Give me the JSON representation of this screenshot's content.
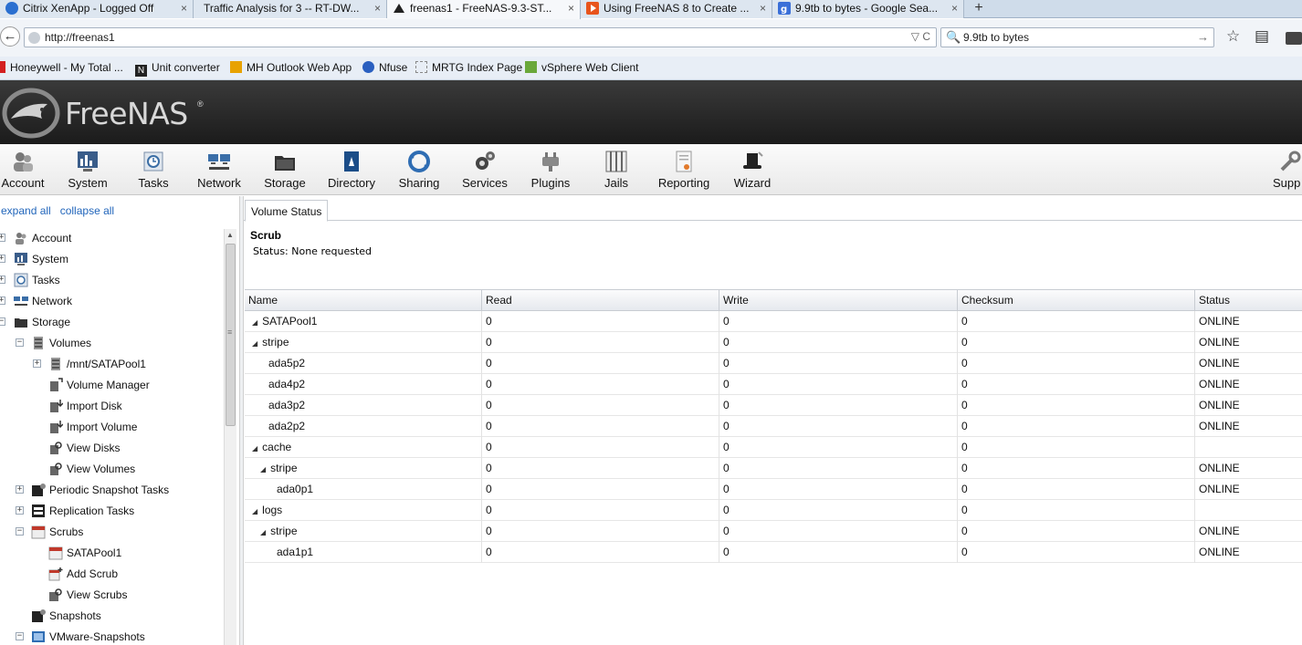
{
  "browser": {
    "tabs": [
      {
        "title": "Citrix XenApp - Logged Off",
        "icon": "citrix-icon",
        "color": "#2a6fd0"
      },
      {
        "title": "Traffic Analysis for 3 -- RT-DW...",
        "icon": "blank-page-icon",
        "color": "#e6e6e6"
      },
      {
        "title": "freenas1 - FreeNAS-9.3-ST...",
        "icon": "freenas-shark-icon",
        "color": "#222222"
      },
      {
        "title": "Using FreeNAS 8 to Create ...",
        "icon": "youtube-play-icon",
        "color": "#e8541c"
      },
      {
        "title": "9.9tb to bytes - Google Sea...",
        "icon": "google-icon",
        "color": "#3a6fd8"
      }
    ],
    "close_glyph": "×",
    "new_tab_glyph": "+",
    "back_glyph": "←",
    "url": "http://freenas1",
    "url_controls": "▽ C",
    "search_value": "9.9tb to bytes",
    "search_glyph": "🔍",
    "search_go": "→",
    "bookmark_star": "☆",
    "reading_list": "▤",
    "bookmarks": [
      {
        "label": "Honeywell - My Total ...",
        "color": "#d32020"
      },
      {
        "label": "Unit converter",
        "color": "#222222"
      },
      {
        "label": "MH Outlook Web App",
        "color": "#e8a200"
      },
      {
        "label": "Nfuse",
        "color": "#2a5fc0"
      },
      {
        "label": "MRTG Index Page",
        "color": "#bbbbbb"
      },
      {
        "label": "vSphere Web Client",
        "color": "#6aa83a"
      }
    ]
  },
  "header": {
    "logo_text": "FreeNAS",
    "logo_reg": "®"
  },
  "toolbar": {
    "items": [
      {
        "label": "Account"
      },
      {
        "label": "System"
      },
      {
        "label": "Tasks"
      },
      {
        "label": "Network"
      },
      {
        "label": "Storage"
      },
      {
        "label": "Directory"
      },
      {
        "label": "Sharing"
      },
      {
        "label": "Services"
      },
      {
        "label": "Plugins"
      },
      {
        "label": "Jails"
      },
      {
        "label": "Reporting"
      },
      {
        "label": "Wizard"
      },
      {
        "label": "Supp"
      }
    ]
  },
  "tree": {
    "expand_all": "expand all",
    "collapse_all": "collapse all",
    "nodes": [
      {
        "label": "Account",
        "exp": "+"
      },
      {
        "label": "System",
        "exp": "+"
      },
      {
        "label": "Tasks",
        "exp": "+"
      },
      {
        "label": "Network",
        "exp": "+"
      },
      {
        "label": "Storage",
        "exp": "−"
      },
      {
        "label": "Volumes",
        "exp": "−"
      },
      {
        "label": "/mnt/SATAPool1",
        "exp": "+"
      },
      {
        "label": "Volume Manager",
        "exp": ""
      },
      {
        "label": "Import Disk",
        "exp": ""
      },
      {
        "label": "Import Volume",
        "exp": ""
      },
      {
        "label": "View Disks",
        "exp": ""
      },
      {
        "label": "View Volumes",
        "exp": ""
      },
      {
        "label": "Periodic Snapshot Tasks",
        "exp": "+"
      },
      {
        "label": "Replication Tasks",
        "exp": "+"
      },
      {
        "label": "Scrubs",
        "exp": "−"
      },
      {
        "label": "SATAPool1",
        "exp": ""
      },
      {
        "label": "Add Scrub",
        "exp": ""
      },
      {
        "label": "View Scrubs",
        "exp": ""
      },
      {
        "label": "Snapshots",
        "exp": ""
      },
      {
        "label": "VMware-Snapshots",
        "exp": "−"
      }
    ],
    "scroll_up": "▲",
    "scroll_grip": "≡"
  },
  "content": {
    "tab_label": "Volume Status",
    "scrub_title": "Scrub",
    "scrub_status": "Status: None requested",
    "columns": [
      "Name",
      "Read",
      "Write",
      "Checksum",
      "Status"
    ],
    "tri_glyph": "◢",
    "rows": [
      {
        "name": "SATAPool1",
        "tri": true,
        "read": "0",
        "write": "0",
        "checksum": "0",
        "status": "ONLINE"
      },
      {
        "name": "stripe",
        "tri": true,
        "read": "0",
        "write": "0",
        "checksum": "0",
        "status": "ONLINE"
      },
      {
        "name": "ada5p2",
        "tri": false,
        "read": "0",
        "write": "0",
        "checksum": "0",
        "status": "ONLINE"
      },
      {
        "name": "ada4p2",
        "tri": false,
        "read": "0",
        "write": "0",
        "checksum": "0",
        "status": "ONLINE"
      },
      {
        "name": "ada3p2",
        "tri": false,
        "read": "0",
        "write": "0",
        "checksum": "0",
        "status": "ONLINE"
      },
      {
        "name": "ada2p2",
        "tri": false,
        "read": "0",
        "write": "0",
        "checksum": "0",
        "status": "ONLINE"
      },
      {
        "name": "cache",
        "tri": true,
        "read": "0",
        "write": "0",
        "checksum": "0",
        "status": ""
      },
      {
        "name": "stripe",
        "tri": true,
        "read": "0",
        "write": "0",
        "checksum": "0",
        "status": "ONLINE"
      },
      {
        "name": "ada0p1",
        "tri": false,
        "read": "0",
        "write": "0",
        "checksum": "0",
        "status": "ONLINE"
      },
      {
        "name": "logs",
        "tri": true,
        "read": "0",
        "write": "0",
        "checksum": "0",
        "status": ""
      },
      {
        "name": "stripe",
        "tri": true,
        "read": "0",
        "write": "0",
        "checksum": "0",
        "status": "ONLINE"
      },
      {
        "name": "ada1p1",
        "tri": false,
        "read": "0",
        "write": "0",
        "checksum": "0",
        "status": "ONLINE"
      }
    ]
  }
}
